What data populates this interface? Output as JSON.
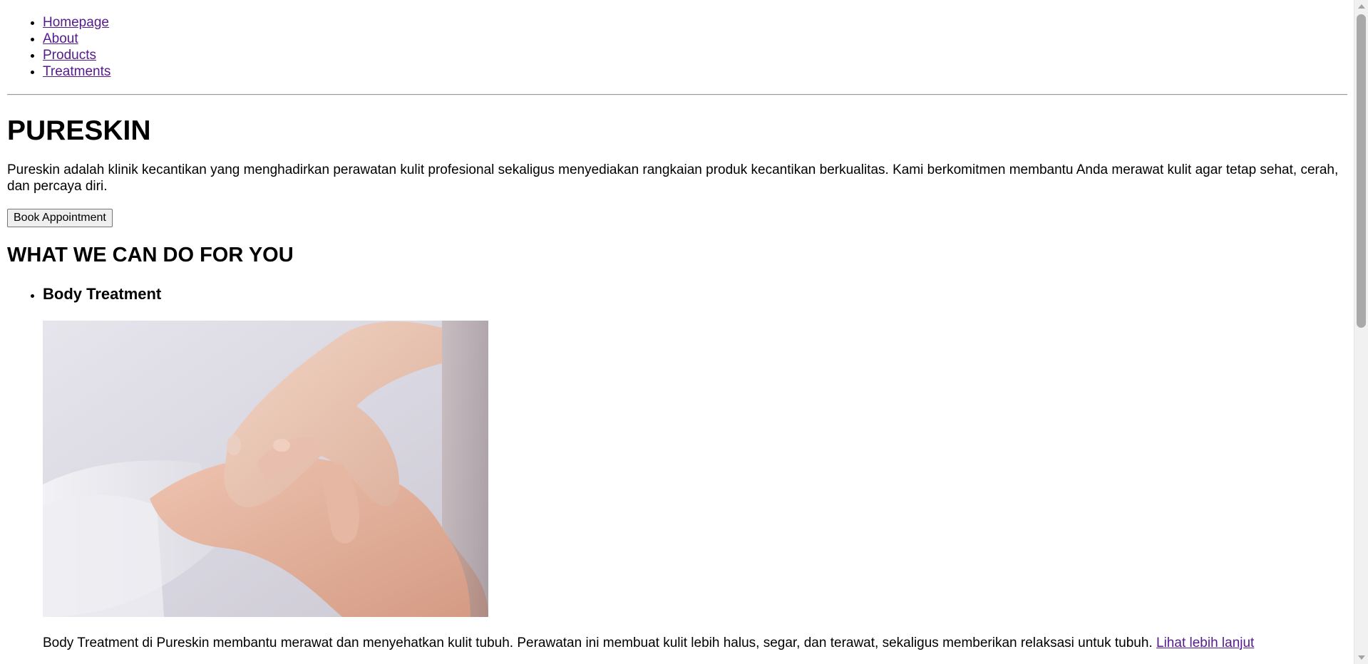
{
  "nav": {
    "items": [
      {
        "label": "Homepage"
      },
      {
        "label": "About"
      },
      {
        "label": "Products"
      },
      {
        "label": "Treatments"
      }
    ]
  },
  "hero": {
    "title": "PURESKIN",
    "intro": "Pureskin adalah klinik kecantikan yang menghadirkan perawatan kulit profesional sekaligus menyediakan rangkaian produk kecantikan berkualitas. Kami berkomitmen membantu Anda merawat kulit agar tetap sehat, cerah, dan percaya diri.",
    "button_label": "Book Appointment"
  },
  "services": {
    "title": "WHAT WE CAN DO FOR YOU",
    "items": [
      {
        "title": "Body Treatment",
        "image_alt": "Body Treatment",
        "description": "Body Treatment di Pureskin membantu merawat dan menyehatkan kulit tubuh. Perawatan ini membuat kulit lebih halus, segar, dan terawat, sekaligus memberikan relaksasi untuk tubuh.",
        "link_label": "Lihat lebih lanjut"
      }
    ]
  },
  "colors": {
    "link": "#551a8b",
    "text": "#000000",
    "background": "#ffffff"
  }
}
